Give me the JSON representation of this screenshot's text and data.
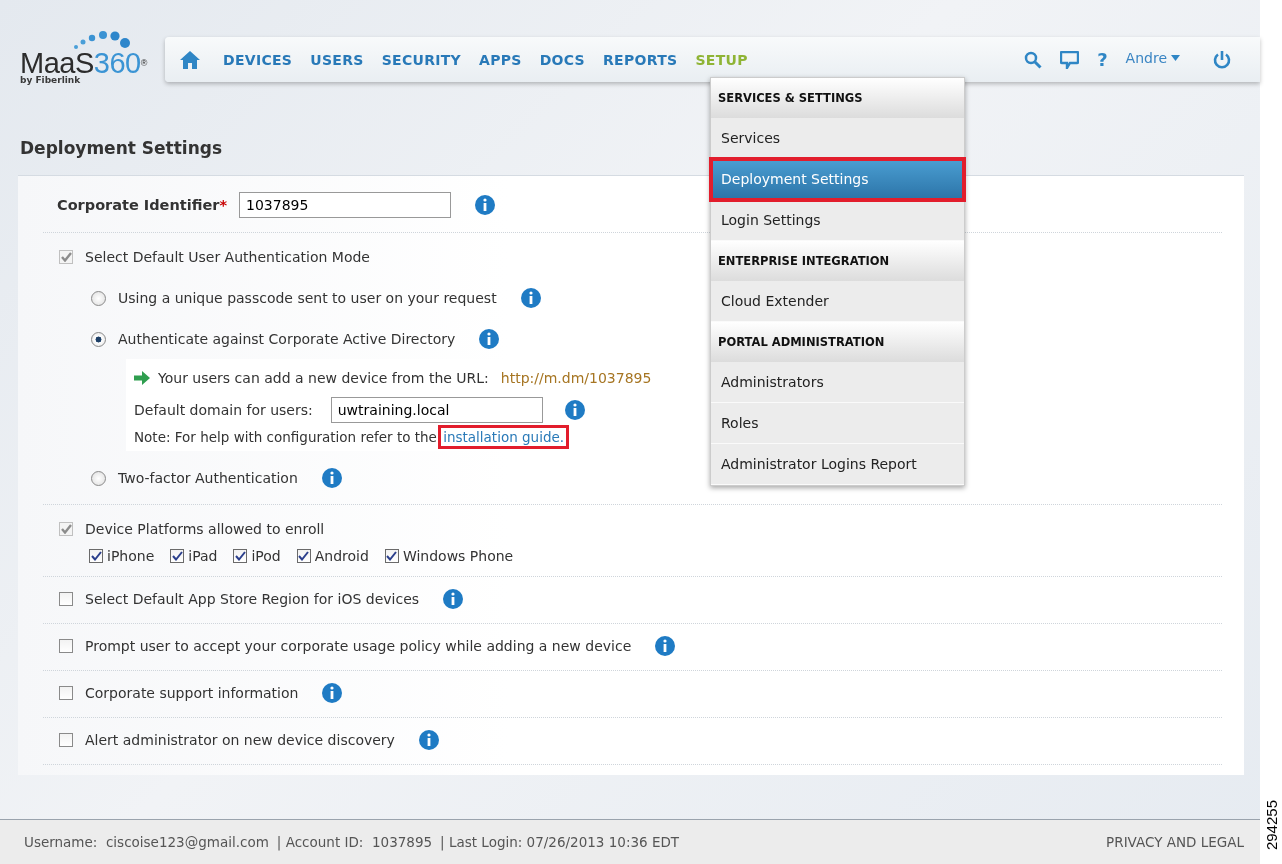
{
  "logo": {
    "name_dark": "MaaS",
    "name_blue": "360",
    "mark": "®",
    "tagline": "by Fiberlink"
  },
  "nav": {
    "items": [
      {
        "label": "DEVICES",
        "selected": false
      },
      {
        "label": "USERS",
        "selected": false
      },
      {
        "label": "SECURITY",
        "selected": false
      },
      {
        "label": "APPS",
        "selected": false
      },
      {
        "label": "DOCS",
        "selected": false
      },
      {
        "label": "REPORTS",
        "selected": false
      },
      {
        "label": "SETUP",
        "selected": true
      }
    ],
    "help": "?",
    "user": "Andre"
  },
  "setup_menu": {
    "sections": [
      {
        "heading": "SERVICES & SETTINGS",
        "items": [
          {
            "label": "Services",
            "selected": false,
            "highlighted": false
          },
          {
            "label": "Deployment Settings",
            "selected": true,
            "highlighted": true
          },
          {
            "label": "Login Settings",
            "selected": false,
            "highlighted": false
          }
        ]
      },
      {
        "heading": "ENTERPRISE INTEGRATION",
        "items": [
          {
            "label": "Cloud Extender",
            "selected": false,
            "highlighted": false
          }
        ]
      },
      {
        "heading": "PORTAL ADMINISTRATION",
        "items": [
          {
            "label": "Administrators",
            "selected": false,
            "highlighted": false
          },
          {
            "label": "Roles",
            "selected": false,
            "highlighted": false
          },
          {
            "label": "Administrator Logins Report",
            "selected": false,
            "highlighted": false
          }
        ]
      }
    ]
  },
  "page_title": "Deployment Settings",
  "corporate_identifier": {
    "label": "Corporate Identifier",
    "required_mark": "*",
    "value": "1037895"
  },
  "auth_mode": {
    "label": "Select Default User Authentication Mode",
    "checked": true,
    "disabled": true,
    "options": [
      {
        "label": "Using a unique passcode sent to user on your request",
        "selected": false
      },
      {
        "label": "Authenticate against Corporate Active Directory",
        "selected": true,
        "details": {
          "url_label": "Your users can add a new device from the URL:",
          "url": "http://m.dm/1037895",
          "domain_label": "Default domain for users:",
          "domain_value": "uwtraining.local",
          "note": "Note:  For help with configuration refer to the",
          "note_link": "installation guide",
          "note_end": ".",
          "link_highlighted": true
        }
      },
      {
        "label": "Two-factor Authentication",
        "selected": false
      }
    ]
  },
  "platforms": {
    "label": "Device Platforms allowed to enroll",
    "checked": true,
    "disabled": true,
    "items": [
      {
        "label": "iPhone",
        "checked": true
      },
      {
        "label": "iPad",
        "checked": true
      },
      {
        "label": "iPod",
        "checked": true
      },
      {
        "label": "Android",
        "checked": true
      },
      {
        "label": "Windows Phone",
        "checked": true
      }
    ]
  },
  "options": [
    {
      "label": "Select Default App Store Region for iOS devices",
      "checked": false,
      "disabled": false
    },
    {
      "label": "Prompt user to accept your corporate usage policy while adding a new device",
      "checked": false,
      "disabled": false
    },
    {
      "label": "Corporate support information",
      "checked": false,
      "disabled": false
    },
    {
      "label": "Alert administrator on new device discovery",
      "checked": false,
      "disabled": false
    }
  ],
  "footer": {
    "items": [
      "Username:  ciscoise123@gmail.com",
      "| Account ID:  1037895",
      "| Last Login: 07/26/2013 10:36 EDT"
    ],
    "privacy": "PRIVACY AND LEGAL"
  },
  "figure_number": "294255"
}
